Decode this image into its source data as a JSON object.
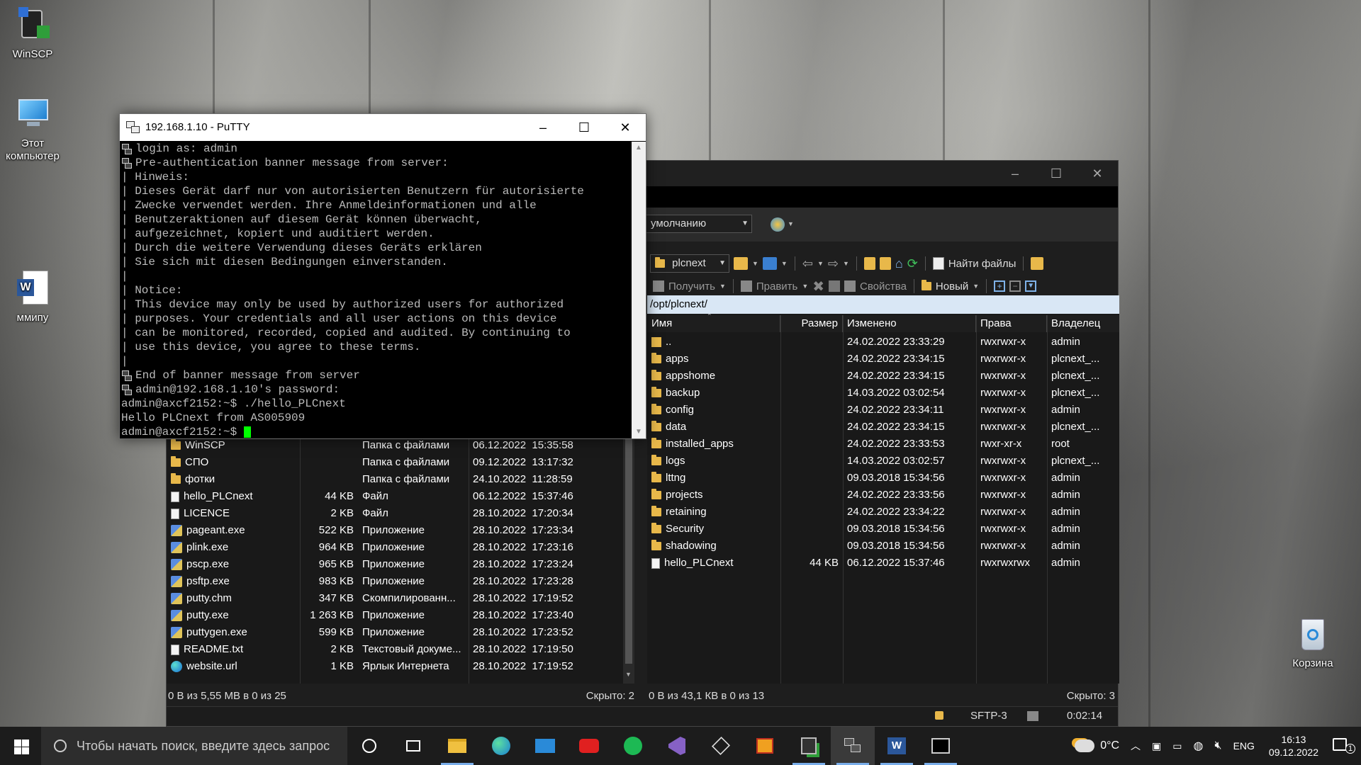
{
  "desktop": {
    "icons": [
      {
        "label": "WinSCP"
      },
      {
        "label": "Этот компьютер"
      },
      {
        "label": "ммипу"
      },
      {
        "label": "Корзина"
      }
    ]
  },
  "putty": {
    "title": "192.168.1.10 - PuTTY",
    "lines": [
      {
        "text": "login as: admin",
        "key": true
      },
      {
        "text": "Pre-authentication banner message from server:",
        "key": true
      },
      {
        "text": "| Hinweis:",
        "key": false
      },
      {
        "text": "| Dieses Gerät darf nur von autorisierten Benutzern für autorisierte",
        "key": false
      },
      {
        "text": "| Zwecke verwendet werden. Ihre Anmeldeinformationen und alle",
        "key": false
      },
      {
        "text": "| Benutzeraktionen auf diesem Gerät können überwacht,",
        "key": false
      },
      {
        "text": "| aufgezeichnet, kopiert und auditiert werden.",
        "key": false
      },
      {
        "text": "| Durch die weitere Verwendung dieses Geräts erklären",
        "key": false
      },
      {
        "text": "| Sie sich mit diesen Bedingungen einverstanden.",
        "key": false
      },
      {
        "text": "|",
        "key": false
      },
      {
        "text": "| Notice:",
        "key": false
      },
      {
        "text": "| This device may only be used by authorized users for authorized",
        "key": false
      },
      {
        "text": "| purposes. Your credentials and all user actions on this device",
        "key": false
      },
      {
        "text": "| can be monitored, recorded, copied and audited. By continuing to",
        "key": false
      },
      {
        "text": "| use this device, you agree to these terms.",
        "key": false
      },
      {
        "text": "|",
        "key": false
      },
      {
        "text": "End of banner message from server",
        "key": true
      },
      {
        "text": "admin@192.168.1.10's password:",
        "key": true
      },
      {
        "text": "admin@axcf2152:~$ ./hello_PLCnext",
        "key": false
      },
      {
        "text": "Hello PLCnext from AS005909",
        "key": false
      },
      {
        "text": "admin@axcf2152:~$ ",
        "key": false,
        "cursor": true
      }
    ]
  },
  "winscp": {
    "session_combo": "умолчанию",
    "remote": {
      "folder_combo": "plcnext",
      "find_files": "Найти файлы",
      "get": "Получить",
      "edit": "Править",
      "properties": "Свойства",
      "new": "Новый",
      "path": "/opt/plcnext/",
      "columns": [
        "Имя",
        "Размер",
        "Изменено",
        "Права",
        "Владелец"
      ],
      "rows": [
        {
          "type": "updir",
          "name": "..",
          "size": "",
          "modified": "24.02.2022 23:33:29",
          "rights": "rwxrwxr-x",
          "owner": "admin"
        },
        {
          "type": "folder",
          "name": "apps",
          "size": "",
          "modified": "24.02.2022 23:34:15",
          "rights": "rwxrwxr-x",
          "owner": "plcnext_..."
        },
        {
          "type": "folder",
          "name": "appshome",
          "size": "",
          "modified": "24.02.2022 23:34:15",
          "rights": "rwxrwxr-x",
          "owner": "plcnext_..."
        },
        {
          "type": "folder",
          "name": "backup",
          "size": "",
          "modified": "14.03.2022 03:02:54",
          "rights": "rwxrwxr-x",
          "owner": "plcnext_..."
        },
        {
          "type": "folder",
          "name": "config",
          "size": "",
          "modified": "24.02.2022 23:34:11",
          "rights": "rwxrwxr-x",
          "owner": "admin"
        },
        {
          "type": "folder",
          "name": "data",
          "size": "",
          "modified": "24.02.2022 23:34:15",
          "rights": "rwxrwxr-x",
          "owner": "plcnext_..."
        },
        {
          "type": "folder",
          "name": "installed_apps",
          "size": "",
          "modified": "24.02.2022 23:33:53",
          "rights": "rwxr-xr-x",
          "owner": "root"
        },
        {
          "type": "folder",
          "name": "logs",
          "size": "",
          "modified": "14.03.2022 03:02:57",
          "rights": "rwxrwxr-x",
          "owner": "plcnext_..."
        },
        {
          "type": "folder",
          "name": "lttng",
          "size": "",
          "modified": "09.03.2018 15:34:56",
          "rights": "rwxrwxr-x",
          "owner": "admin"
        },
        {
          "type": "folder",
          "name": "projects",
          "size": "",
          "modified": "24.02.2022 23:33:56",
          "rights": "rwxrwxr-x",
          "owner": "admin"
        },
        {
          "type": "folder",
          "name": "retaining",
          "size": "",
          "modified": "24.02.2022 23:34:22",
          "rights": "rwxrwxr-x",
          "owner": "admin"
        },
        {
          "type": "folder",
          "name": "Security",
          "size": "",
          "modified": "09.03.2018 15:34:56",
          "rights": "rwxrwxr-x",
          "owner": "admin"
        },
        {
          "type": "folder",
          "name": "shadowing",
          "size": "",
          "modified": "09.03.2018 15:34:56",
          "rights": "rwxrwxr-x",
          "owner": "admin"
        },
        {
          "type": "file",
          "name": "hello_PLCnext",
          "size": "44 KB",
          "modified": "06.12.2022 15:37:46",
          "rights": "rwxrwxrwx",
          "owner": "admin"
        }
      ],
      "status": "0 В из 43,1 КВ в 0 из 13",
      "hidden": "Скрыто: 3"
    },
    "local": {
      "rows": [
        {
          "type": "folder",
          "name": "WinSCP",
          "size": "",
          "kind": "Папка с файлами",
          "modified": "06.12.2022  15:35:58"
        },
        {
          "type": "folder",
          "name": "СПО",
          "size": "",
          "kind": "Папка с файлами",
          "modified": "09.12.2022  13:17:32"
        },
        {
          "type": "folder",
          "name": "фотки",
          "size": "",
          "kind": "Папка с файлами",
          "modified": "24.10.2022  11:28:59"
        },
        {
          "type": "file",
          "name": "hello_PLCnext",
          "size": "44 KB",
          "kind": "Файл",
          "modified": "06.12.2022  15:37:46"
        },
        {
          "type": "file",
          "name": "LICENCE",
          "size": "2 KB",
          "kind": "Файл",
          "modified": "28.10.2022  17:20:34"
        },
        {
          "type": "exe",
          "name": "pageant.exe",
          "size": "522 KB",
          "kind": "Приложение",
          "modified": "28.10.2022  17:23:34"
        },
        {
          "type": "exe",
          "name": "plink.exe",
          "size": "964 KB",
          "kind": "Приложение",
          "modified": "28.10.2022  17:23:16"
        },
        {
          "type": "exe",
          "name": "pscp.exe",
          "size": "965 KB",
          "kind": "Приложение",
          "modified": "28.10.2022  17:23:24"
        },
        {
          "type": "exe",
          "name": "psftp.exe",
          "size": "983 KB",
          "kind": "Приложение",
          "modified": "28.10.2022  17:23:28"
        },
        {
          "type": "exe",
          "name": "putty.chm",
          "size": "347 KB",
          "kind": "Скомпилированн...",
          "modified": "28.10.2022  17:19:52"
        },
        {
          "type": "exe",
          "name": "putty.exe",
          "size": "1 263 KB",
          "kind": "Приложение",
          "modified": "28.10.2022  17:23:40"
        },
        {
          "type": "exe",
          "name": "puttygen.exe",
          "size": "599 KB",
          "kind": "Приложение",
          "modified": "28.10.2022  17:23:52"
        },
        {
          "type": "file",
          "name": "README.txt",
          "size": "2 KB",
          "kind": "Текстовый докуме...",
          "modified": "28.10.2022  17:19:50"
        },
        {
          "type": "web",
          "name": "website.url",
          "size": "1 KB",
          "kind": "Ярлык Интернета",
          "modified": "28.10.2022  17:19:52"
        }
      ],
      "status": "0 В из 5,55 МВ в 0 из 25",
      "hidden": "Скрыто: 2"
    },
    "bottom": {
      "protocol": "SFTP-3",
      "elapsed": "0:02:14"
    }
  },
  "taskbar": {
    "search_placeholder": "Чтобы начать поиск, введите здесь запрос",
    "weather": "0°C",
    "language": "ENG",
    "time": "16:13",
    "date": "09.12.2022",
    "notifications": "1"
  },
  "colors": {
    "accent": "#7aaeea",
    "terminal_cursor": "#00ff00",
    "path_bar": "#d9e7f5",
    "folder": "#e8b84a"
  }
}
